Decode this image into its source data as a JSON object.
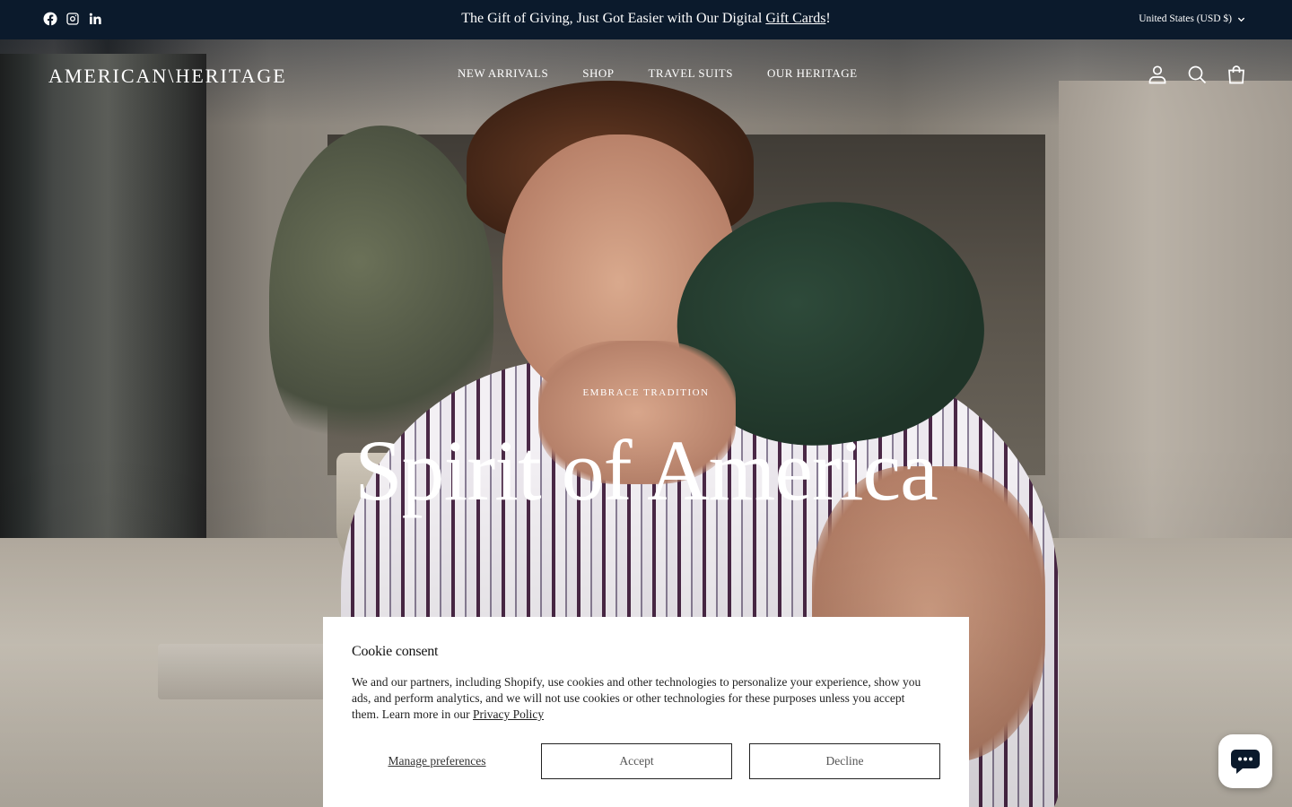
{
  "announcement": {
    "text_before": "The Gift of Giving, Just Got Easier with Our Digital ",
    "link": "Gift Cards",
    "text_after": "!",
    "currency": "United States (USD $)"
  },
  "social": [
    "facebook-icon",
    "instagram-icon",
    "linkedin-icon"
  ],
  "header": {
    "logo": "AMERICAN\\HERITAGE",
    "nav": [
      "NEW ARRIVALS",
      "SHOP",
      "TRAVEL SUITS",
      "OUR HERITAGE"
    ],
    "icons": [
      "account-icon",
      "search-icon",
      "cart-icon"
    ]
  },
  "hero": {
    "eyebrow": "EMBRACE TRADITION",
    "title": "Spirit of America"
  },
  "cookie": {
    "title": "Cookie consent",
    "body": "We and our partners, including Shopify, use cookies and other technologies to personalize your experience, show you ads, and perform analytics, and we will not use cookies or other technologies for these purposes unless you accept them. Learn more in our ",
    "policy_link": "Privacy Policy",
    "manage": "Manage preferences",
    "accept": "Accept",
    "decline": "Decline"
  },
  "colors": {
    "announcement_bg": "#0b1a2c",
    "chat_accent": "#0b1a2c"
  }
}
